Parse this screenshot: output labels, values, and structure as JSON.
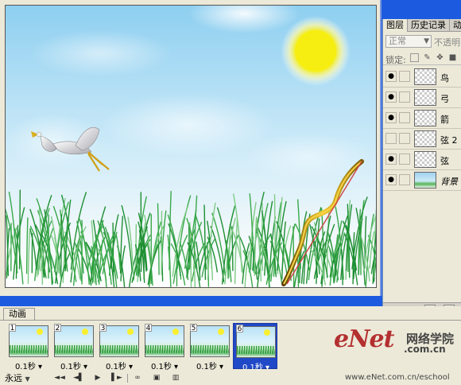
{
  "layers_panel": {
    "tabs": [
      "图层",
      "历史记录",
      "动"
    ],
    "blend_mode": "正常",
    "opacity_label": "不透明",
    "lock_label": "锁定:",
    "layers": [
      {
        "name": "鸟",
        "visible": true
      },
      {
        "name": "弓",
        "visible": true
      },
      {
        "name": "箭",
        "visible": true
      },
      {
        "name": "弦 2",
        "visible": false
      },
      {
        "name": "弦",
        "visible": true
      },
      {
        "name": "背景",
        "visible": true
      }
    ]
  },
  "animation_panel": {
    "tab_label": "动画",
    "frames": [
      {
        "number": "1",
        "delay": "0.1秒",
        "selected": false
      },
      {
        "number": "2",
        "delay": "0.1秒",
        "selected": false
      },
      {
        "number": "3",
        "delay": "0.1秒",
        "selected": false
      },
      {
        "number": "4",
        "delay": "0.1秒",
        "selected": false
      },
      {
        "number": "5",
        "delay": "0.1秒",
        "selected": false
      },
      {
        "number": "6",
        "delay": "0.1秒",
        "selected": true
      }
    ],
    "loop_option": "永远"
  },
  "watermark": {
    "logo": "eNet",
    "chinese": "网络学院",
    "domain": ".com.cn",
    "url": "www.eNet.com.cn/eschool"
  },
  "colors": {
    "sky_top": "#8fd0f0",
    "sun": "#f6f020",
    "grass": "#3aa84a",
    "bow": "#e0b020",
    "bowstring": "#d04040",
    "selection": "#2049c8"
  }
}
